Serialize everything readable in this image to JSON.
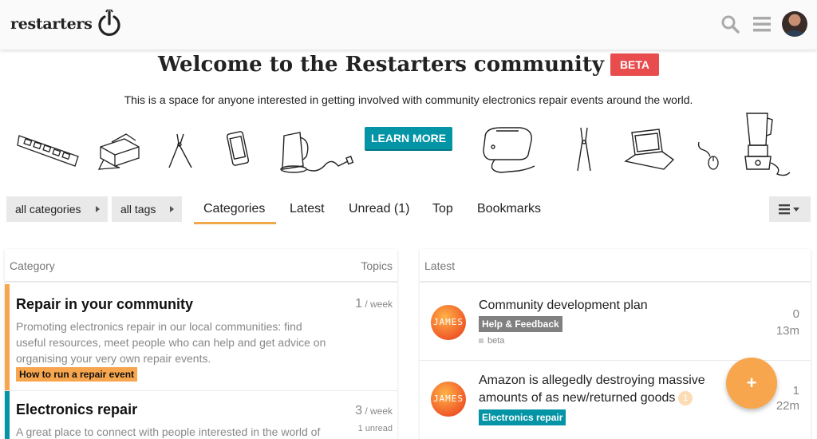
{
  "header": {
    "logo_text": "restarters",
    "icons": [
      "search-icon",
      "hamburger-menu-icon",
      "user-avatar"
    ]
  },
  "banner": {
    "title": "Welcome to the Restarters community",
    "beta": "BETA",
    "subtitle": "This is a space for anyone interested in getting involved with community electronics repair events around the world.",
    "learn_more": "LEARN MORE",
    "illustrations": [
      "ram-stick",
      "printer",
      "pliers",
      "smartphone",
      "kettle",
      "toaster",
      "wire-cutters",
      "laptop",
      "mouse",
      "blender"
    ]
  },
  "nav": {
    "categories_dropdown": "all categories",
    "tags_dropdown": "all tags",
    "tabs": [
      {
        "label": "Categories",
        "active": true
      },
      {
        "label": "Latest",
        "active": false
      },
      {
        "label": "Unread (1)",
        "active": false
      },
      {
        "label": "Top",
        "active": false
      },
      {
        "label": "Bookmarks",
        "active": false
      }
    ]
  },
  "categories_panel": {
    "col_category": "Category",
    "col_topics": "Topics",
    "rows": [
      {
        "title": "Repair in your community",
        "description": "Promoting electronics repair in our local communities: find useful resources, meet people who can help and get advice on organising your very own repair events.",
        "subcategory": "How to run a repair event",
        "count": "1",
        "period": " / week",
        "unread": "",
        "color": "#f7a64e"
      },
      {
        "title": "Electronics repair",
        "description": "A great place to connect with people interested in the world of",
        "subcategory": "",
        "count": "3",
        "period": " / week",
        "unread": "1 unread",
        "color": "#0394a6"
      }
    ]
  },
  "latest_panel": {
    "heading": "Latest",
    "topics": [
      {
        "avatar_text": "JAMES",
        "title": "Community development plan",
        "category": "Help & Feedback",
        "category_color": "#808080",
        "tag": "beta",
        "replies": "0",
        "age": "13m",
        "new_count": ""
      },
      {
        "avatar_text": "JAMES",
        "title": "Amazon is allegedly destroying massive amounts of as new/returned goods",
        "category": "Electronics repair",
        "category_color": "#0394a6",
        "tag": "",
        "replies": "1",
        "age": "22m",
        "new_count": "1"
      }
    ]
  },
  "fab_label": "+"
}
